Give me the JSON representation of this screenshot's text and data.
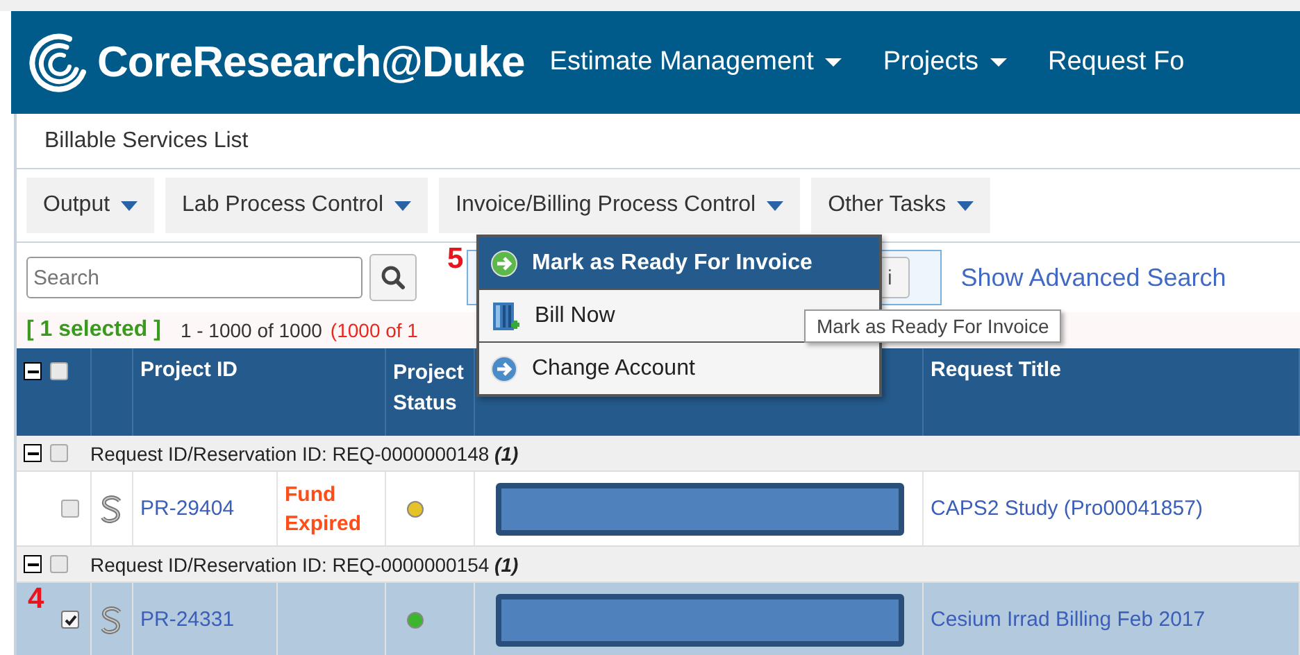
{
  "header": {
    "brand": "CoreResearch@Duke",
    "nav": [
      {
        "label": "Estimate Management",
        "caret": true
      },
      {
        "label": "Projects",
        "caret": true
      },
      {
        "label": "Request Fo",
        "caret": false
      }
    ]
  },
  "page_title": "Billable Services List",
  "toolbar": [
    {
      "label": "Output"
    },
    {
      "label": "Lab Process Control"
    },
    {
      "label": "Invoice/Billing Process Control"
    },
    {
      "label": "Other Tasks"
    }
  ],
  "search": {
    "placeholder": "Search",
    "info_button": "i",
    "advanced_link": "Show Advanced Search",
    "marker": "5"
  },
  "status": {
    "selected": "[ 1 selected ]",
    "range": "1 - 1000 of 1000",
    "filtered": "(1000 of 1"
  },
  "menu": [
    {
      "label": "Mark as Ready For Invoice",
      "kind": "green-arrow",
      "selected": true
    },
    {
      "label": "Bill Now",
      "kind": "building",
      "selected": false
    },
    {
      "label": "Change Account",
      "kind": "blue-arrow",
      "selected": false
    }
  ],
  "tooltip": "Mark as Ready For Invoice",
  "table": {
    "expanded": true,
    "checked": false,
    "columns": [
      "Project ID",
      "Project Status",
      "Request Title"
    ],
    "groups": [
      {
        "label": "Request ID/Reservation ID: REQ-0000000148",
        "count": "(1)",
        "expanded": true,
        "checked": false,
        "rows": [
          {
            "project_id": "PR-29404",
            "fund": "Fund Expired",
            "color": "#e6c229",
            "redacted": true,
            "title": "CAPS2 Study (Pro00041857)",
            "checked": false,
            "selected": false
          }
        ]
      },
      {
        "label": "Request ID/Reservation ID: REQ-0000000154",
        "count": "(1)",
        "expanded": true,
        "checked": false,
        "rows": [
          {
            "project_id": "PR-24331",
            "color": "#3cb52f",
            "redacted": true,
            "title": "Cesium Irrad Billing Feb 2017",
            "checked": true,
            "selected": true,
            "marker": "4"
          }
        ]
      }
    ]
  }
}
